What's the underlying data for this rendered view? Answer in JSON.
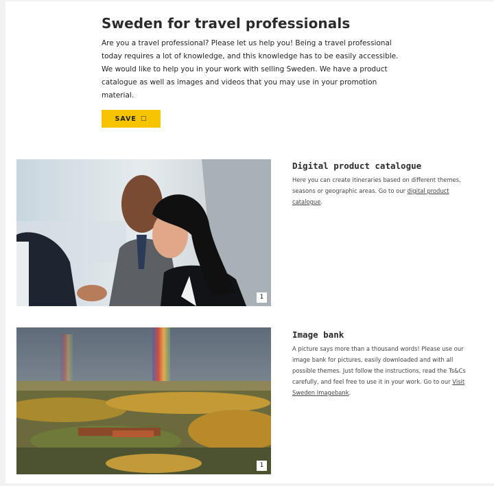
{
  "intro": {
    "title": "Sweden for travel professionals",
    "body": "Are you a travel professional? Please let us help you! Being a travel professional today requires a lot of knowledge, and this knowledge has to be easily accessible. We would like to help you in your work with selling Sweden. We have a product catalogue as well as images and videos that you may use in your promotion material.",
    "save_label": "SAVE",
    "save_icon": "bookmark-icon"
  },
  "cards": [
    {
      "image_badge": "1",
      "title": "Digital product catalogue",
      "text": "Here you can create itineraries based on different themes, seasons or geographic areas. Go to our ",
      "link": "digital product catalogue",
      "text_after": "."
    },
    {
      "image_badge": "1",
      "title": "Image bank",
      "text": "A picture says more than a thousand words! Please use our image bank for pictures, easily downloaded and with all possible themes. Just follow the instructions, read the Ts&Cs carefully, and feel free to use it in your work. Go to our ",
      "link": "Visit Sweden Imagebank",
      "text_after": "."
    }
  ],
  "colors": {
    "accent": "#f6c400"
  }
}
